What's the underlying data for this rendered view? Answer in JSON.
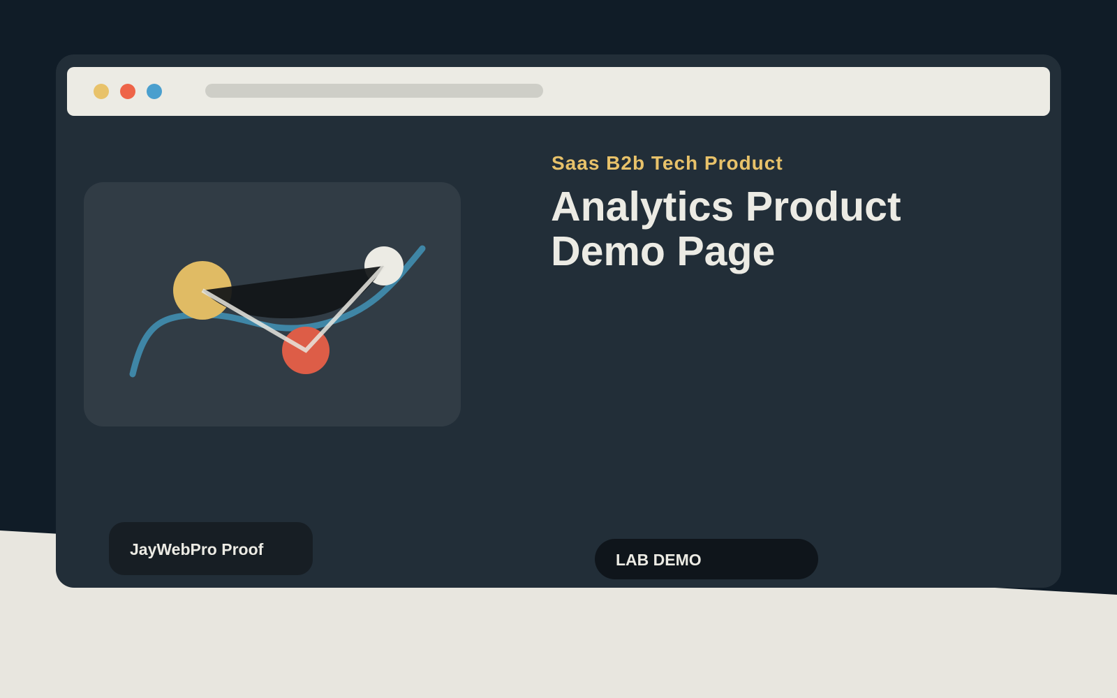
{
  "colors": {
    "page_background": "#101c27",
    "window_background": "#222e38",
    "toolbar_background": "#ecebe4",
    "address_bar": "#cecec7",
    "card_background": "#313c45",
    "ground_band": "#e8e6df",
    "accent_yellow": "#e8c26a",
    "accent_red": "#ee6448",
    "accent_blue": "#4a9fce",
    "curve_blue": "#3f86a6",
    "text_light": "#ecebe4"
  },
  "toolbar": {
    "dots": [
      "#e8c26a",
      "#ee6448",
      "#4a9fce"
    ]
  },
  "hero": {
    "eyebrow": "Saas B2b Tech Product",
    "title_lines": [
      "Analytics Product",
      "Demo Page"
    ]
  },
  "badges": {
    "proof_label": "JayWebPro Proof",
    "lab_label": "LAB DEMO"
  }
}
